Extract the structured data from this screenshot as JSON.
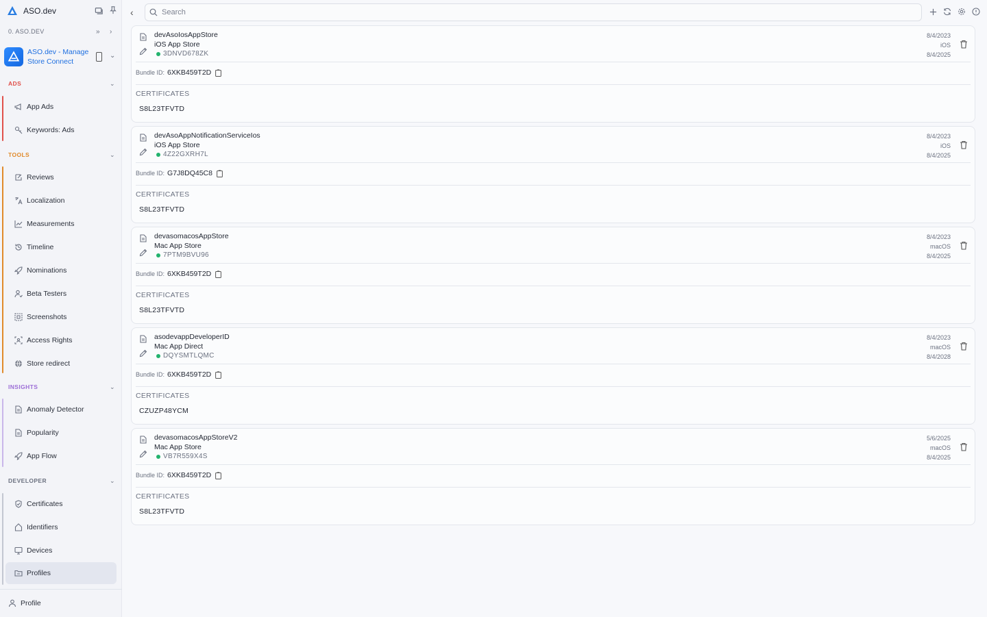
{
  "brand": {
    "name": "ASO.dev"
  },
  "org": {
    "label": "0. ASO.DEV"
  },
  "app": {
    "name": "ASO.dev - Manage Store Connect"
  },
  "colors": {
    "ads": "#e0504a",
    "tools": "#e08a2a",
    "insights": "#9b6cd6",
    "developer": "#6b7180",
    "accent": "#1e6fe0",
    "status_green": "#23b36e"
  },
  "sections": {
    "ads": {
      "title": "ADS",
      "items": [
        {
          "label": "App Ads",
          "icon": "megaphone-icon"
        },
        {
          "label": "Keywords: Ads",
          "icon": "keywords-icon"
        }
      ]
    },
    "tools": {
      "title": "TOOLS",
      "items": [
        {
          "label": "Reviews",
          "icon": "reviews-icon"
        },
        {
          "label": "Localization",
          "icon": "translate-icon"
        },
        {
          "label": "Measurements",
          "icon": "chart-icon"
        },
        {
          "label": "Timeline",
          "icon": "history-icon"
        },
        {
          "label": "Nominations",
          "icon": "rocket-icon"
        },
        {
          "label": "Beta Testers",
          "icon": "tester-icon"
        },
        {
          "label": "Screenshots",
          "icon": "screenshot-icon"
        },
        {
          "label": "Access Rights",
          "icon": "access-icon"
        },
        {
          "label": "Store redirect",
          "icon": "globe-icon"
        }
      ]
    },
    "insights": {
      "title": "INSIGHTS",
      "items": [
        {
          "label": "Anomaly Detector",
          "icon": "document-icon"
        },
        {
          "label": "Popularity",
          "icon": "document-icon"
        },
        {
          "label": "App Flow",
          "icon": "flow-icon"
        }
      ]
    },
    "developer": {
      "title": "DEVELOPER",
      "items": [
        {
          "label": "Certificates",
          "icon": "shield-icon"
        },
        {
          "label": "Identifiers",
          "icon": "tag-icon"
        },
        {
          "label": "Devices",
          "icon": "monitor-icon"
        },
        {
          "label": "Profiles",
          "icon": "folder-icon"
        }
      ]
    }
  },
  "footer": {
    "profile_label": "Profile"
  },
  "search": {
    "placeholder": "Search"
  },
  "labels": {
    "bundle": "Bundle ID:",
    "certificates": "CERTIFICATES"
  },
  "profiles": [
    {
      "name": "devAsoIosAppStore",
      "store": "iOS App Store",
      "team": "3DNVD678ZK",
      "created": "8/4/2023",
      "platform": "iOS",
      "expires": "8/4/2025",
      "bundle_id": "6XKB459T2D",
      "certificate": "S8L23TFVTD"
    },
    {
      "name": "devAsoAppNotificationServiceIos",
      "store": "iOS App Store",
      "team": "4Z22GXRH7L",
      "created": "8/4/2023",
      "platform": "iOS",
      "expires": "8/4/2025",
      "bundle_id": "G7J8DQ45C8",
      "certificate": "S8L23TFVTD"
    },
    {
      "name": "devasomacosAppStore",
      "store": "Mac App Store",
      "team": "7PTM9BVU96",
      "created": "8/4/2023",
      "platform": "macOS",
      "expires": "8/4/2025",
      "bundle_id": "6XKB459T2D",
      "certificate": "S8L23TFVTD"
    },
    {
      "name": "asodevappDeveloperID",
      "store": "Mac App Direct",
      "team": "DQYSMTLQMC",
      "created": "8/4/2023",
      "platform": "macOS",
      "expires": "8/4/2028",
      "bundle_id": "6XKB459T2D",
      "certificate": "CZUZP48YCM"
    },
    {
      "name": "devasomacosAppStoreV2",
      "store": "Mac App Store",
      "team": "VB7R559X4S",
      "created": "5/6/2025",
      "platform": "macOS",
      "expires": "8/4/2025",
      "bundle_id": "6XKB459T2D",
      "certificate": "S8L23TFVTD"
    }
  ]
}
